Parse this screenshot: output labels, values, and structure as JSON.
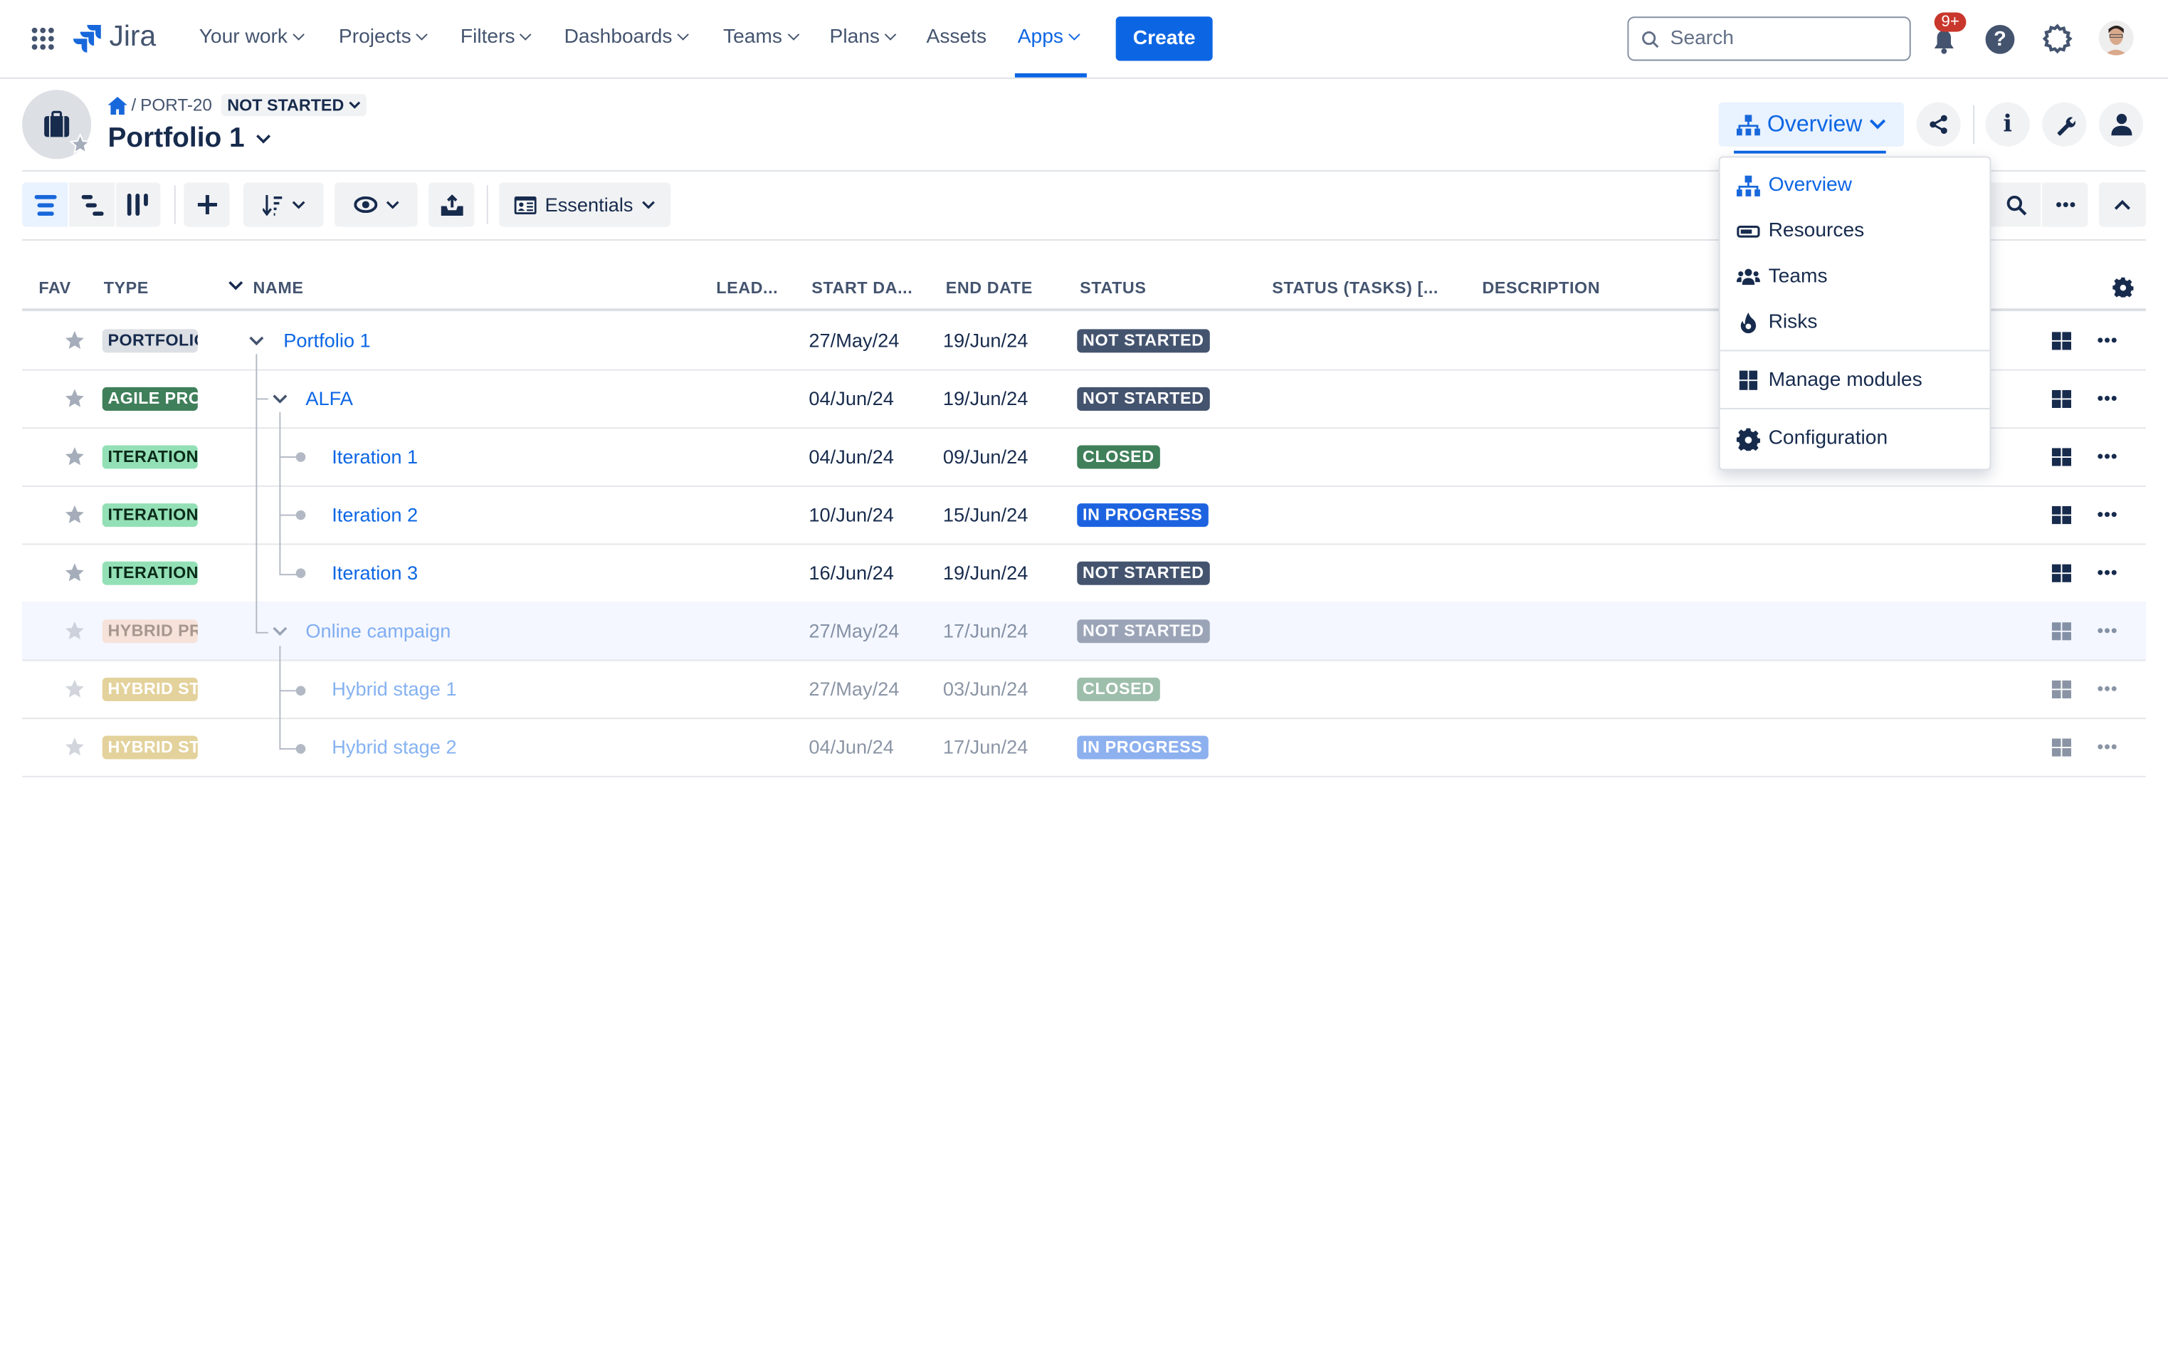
{
  "nav": {
    "product": "Jira",
    "items": [
      {
        "label": "Your work",
        "dropdown": true
      },
      {
        "label": "Projects",
        "dropdown": true
      },
      {
        "label": "Filters",
        "dropdown": true
      },
      {
        "label": "Dashboards",
        "dropdown": true
      },
      {
        "label": "Teams",
        "dropdown": true
      },
      {
        "label": "Plans",
        "dropdown": true
      },
      {
        "label": "Assets",
        "dropdown": false
      },
      {
        "label": "Apps",
        "dropdown": true,
        "active": true
      }
    ],
    "create_label": "Create",
    "search_placeholder": "Search",
    "notification_badge": "9+",
    "accent": "#0c66e4"
  },
  "header": {
    "breadcrumb_key": "PORT-20",
    "breadcrumb_sep": "/",
    "status": "NOT STARTED",
    "title": "Portfolio 1",
    "view_button": "Overview"
  },
  "toolbar": {
    "essentials_label": "Essentials"
  },
  "menu": {
    "items": [
      "Overview",
      "Resources",
      "Teams",
      "Risks"
    ],
    "manage": "Manage modules",
    "config": "Configuration"
  },
  "table": {
    "columns": [
      "FAV",
      "TYPE",
      "NAME",
      "LEAD...",
      "START DA...",
      "END DATE",
      "STATUS",
      "STATUS (TASKS) [...",
      "DESCRIPTION"
    ],
    "rows": [
      {
        "type": "PORTFOLIO",
        "type_bg": "#dcdfe4",
        "type_fg": "#172b4d",
        "name": "Portfolio 1",
        "level": 0,
        "expandable": true,
        "start": "27/May/24",
        "end": "19/Jun/24",
        "status": "NOT STARTED",
        "status_color": "#44546f",
        "faded": false
      },
      {
        "type": "AGILE PROJ",
        "type_bg": "#3f7f5a",
        "type_fg": "#ffffff",
        "name": "ALFA",
        "level": 1,
        "expandable": true,
        "start": "04/Jun/24",
        "end": "19/Jun/24",
        "status": "NOT STARTED",
        "status_color": "#44546f",
        "faded": false
      },
      {
        "type": "ITERATION",
        "type_bg": "#94e0b6",
        "type_fg": "#0b2b1a",
        "name": "Iteration 1",
        "level": 2,
        "expandable": false,
        "start": "04/Jun/24",
        "end": "09/Jun/24",
        "status": "CLOSED",
        "status_color": "#3f7f5a",
        "faded": false
      },
      {
        "type": "ITERATION",
        "type_bg": "#94e0b6",
        "type_fg": "#0b2b1a",
        "name": "Iteration 2",
        "level": 2,
        "expandable": false,
        "start": "10/Jun/24",
        "end": "15/Jun/24",
        "status": "IN PROGRESS",
        "status_color": "#1d63e0",
        "faded": false
      },
      {
        "type": "ITERATION",
        "type_bg": "#94e0b6",
        "type_fg": "#0b2b1a",
        "name": "Iteration 3",
        "level": 2,
        "expandable": false,
        "start": "16/Jun/24",
        "end": "19/Jun/24",
        "status": "NOT STARTED",
        "status_color": "#44546f",
        "faded": false
      },
      {
        "type": "HYBRID PROJ",
        "type_bg": "#f8cfb3",
        "type_fg": "#5a3a20",
        "name": "Online campaign",
        "level": 1,
        "expandable": true,
        "start": "27/May/24",
        "end": "17/Jun/24",
        "status": "NOT STARTED",
        "status_color": "#44546f",
        "faded": true,
        "highlight": true
      },
      {
        "type": "HYBRID STAGE",
        "type_bg": "#c9a53a",
        "type_fg": "#ffffff",
        "name": "Hybrid stage 1",
        "level": 2,
        "expandable": false,
        "start": "27/May/24",
        "end": "03/Jun/24",
        "status": "CLOSED",
        "status_color": "#3f7f5a",
        "faded": true
      },
      {
        "type": "HYBRID STAGE",
        "type_bg": "#c9a53a",
        "type_fg": "#ffffff",
        "name": "Hybrid stage 2",
        "level": 2,
        "expandable": false,
        "start": "04/Jun/24",
        "end": "17/Jun/24",
        "status": "IN PROGRESS",
        "status_color": "#1d63e0",
        "faded": true
      }
    ]
  }
}
